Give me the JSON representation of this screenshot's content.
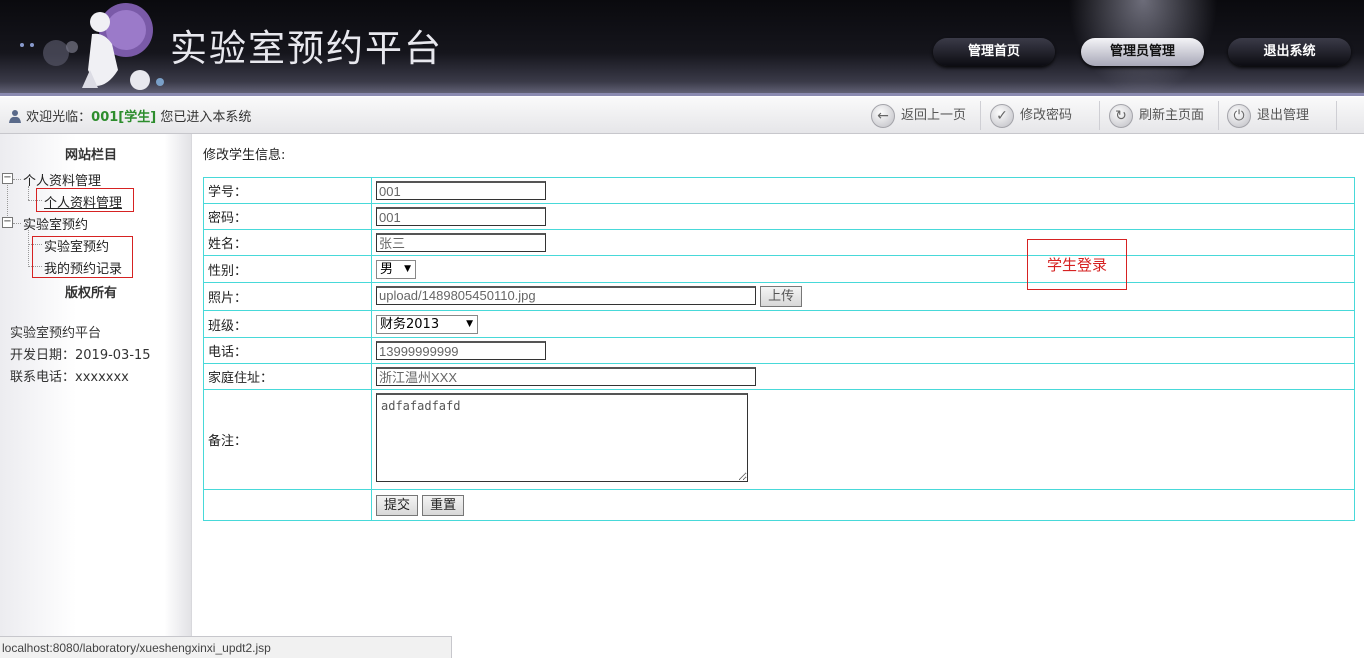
{
  "header": {
    "site_title": "实验室预约平台",
    "nav": [
      {
        "label": "管理首页"
      },
      {
        "label": "管理员管理"
      },
      {
        "label": "退出系统"
      }
    ]
  },
  "infobar": {
    "welcome_prefix": "欢迎光临：",
    "user": "001[学生]",
    "welcome_suffix": " 您已进入本系统",
    "tools": [
      {
        "label": "返回上一页",
        "icon": "back-arrow-icon"
      },
      {
        "label": "修改密码",
        "icon": "key-icon"
      },
      {
        "label": "刷新主页面",
        "icon": "refresh-icon"
      },
      {
        "label": "退出管理",
        "icon": "power-icon"
      }
    ]
  },
  "sidebar": {
    "heading": "网站栏目",
    "groups": [
      {
        "label": "个人资料管理",
        "items": [
          "个人资料管理"
        ]
      },
      {
        "label": "实验室预约",
        "items": [
          "实验室预约",
          "我的预约记录"
        ]
      }
    ],
    "copyright_heading": "版权所有",
    "footer_lines": [
      "实验室预约平台",
      "开发日期：2019-03-15",
      "联系电话：xxxxxxx"
    ]
  },
  "content": {
    "title": "修改学生信息:",
    "fields": {
      "xuehao": {
        "label": "学号：",
        "value": "001"
      },
      "mima": {
        "label": "密码：",
        "value": "001"
      },
      "xingming": {
        "label": "姓名：",
        "value": "张三"
      },
      "xingbie": {
        "label": "性别：",
        "value": "男"
      },
      "zhaopian": {
        "label": "照片：",
        "value": "upload/1489805450110.jpg",
        "button": "上传"
      },
      "banji": {
        "label": "班级：",
        "value": "财务2013"
      },
      "dianhua": {
        "label": "电话：",
        "value": "13999999999"
      },
      "zhuzhi": {
        "label": "家庭住址：",
        "value": "浙江温州XXX"
      },
      "beizhu": {
        "label": "备注：",
        "value": "adfafadfafd"
      }
    },
    "submit_label": "提交",
    "reset_label": "重置"
  },
  "stamp": "学生登录",
  "status_url": "localhost:8080/laboratory/xueshengxinxi_updt2.jsp",
  "colors": {
    "table_border": "#47d9d9",
    "annotation_red": "#d62222",
    "user_green": "#2d8d2d"
  }
}
